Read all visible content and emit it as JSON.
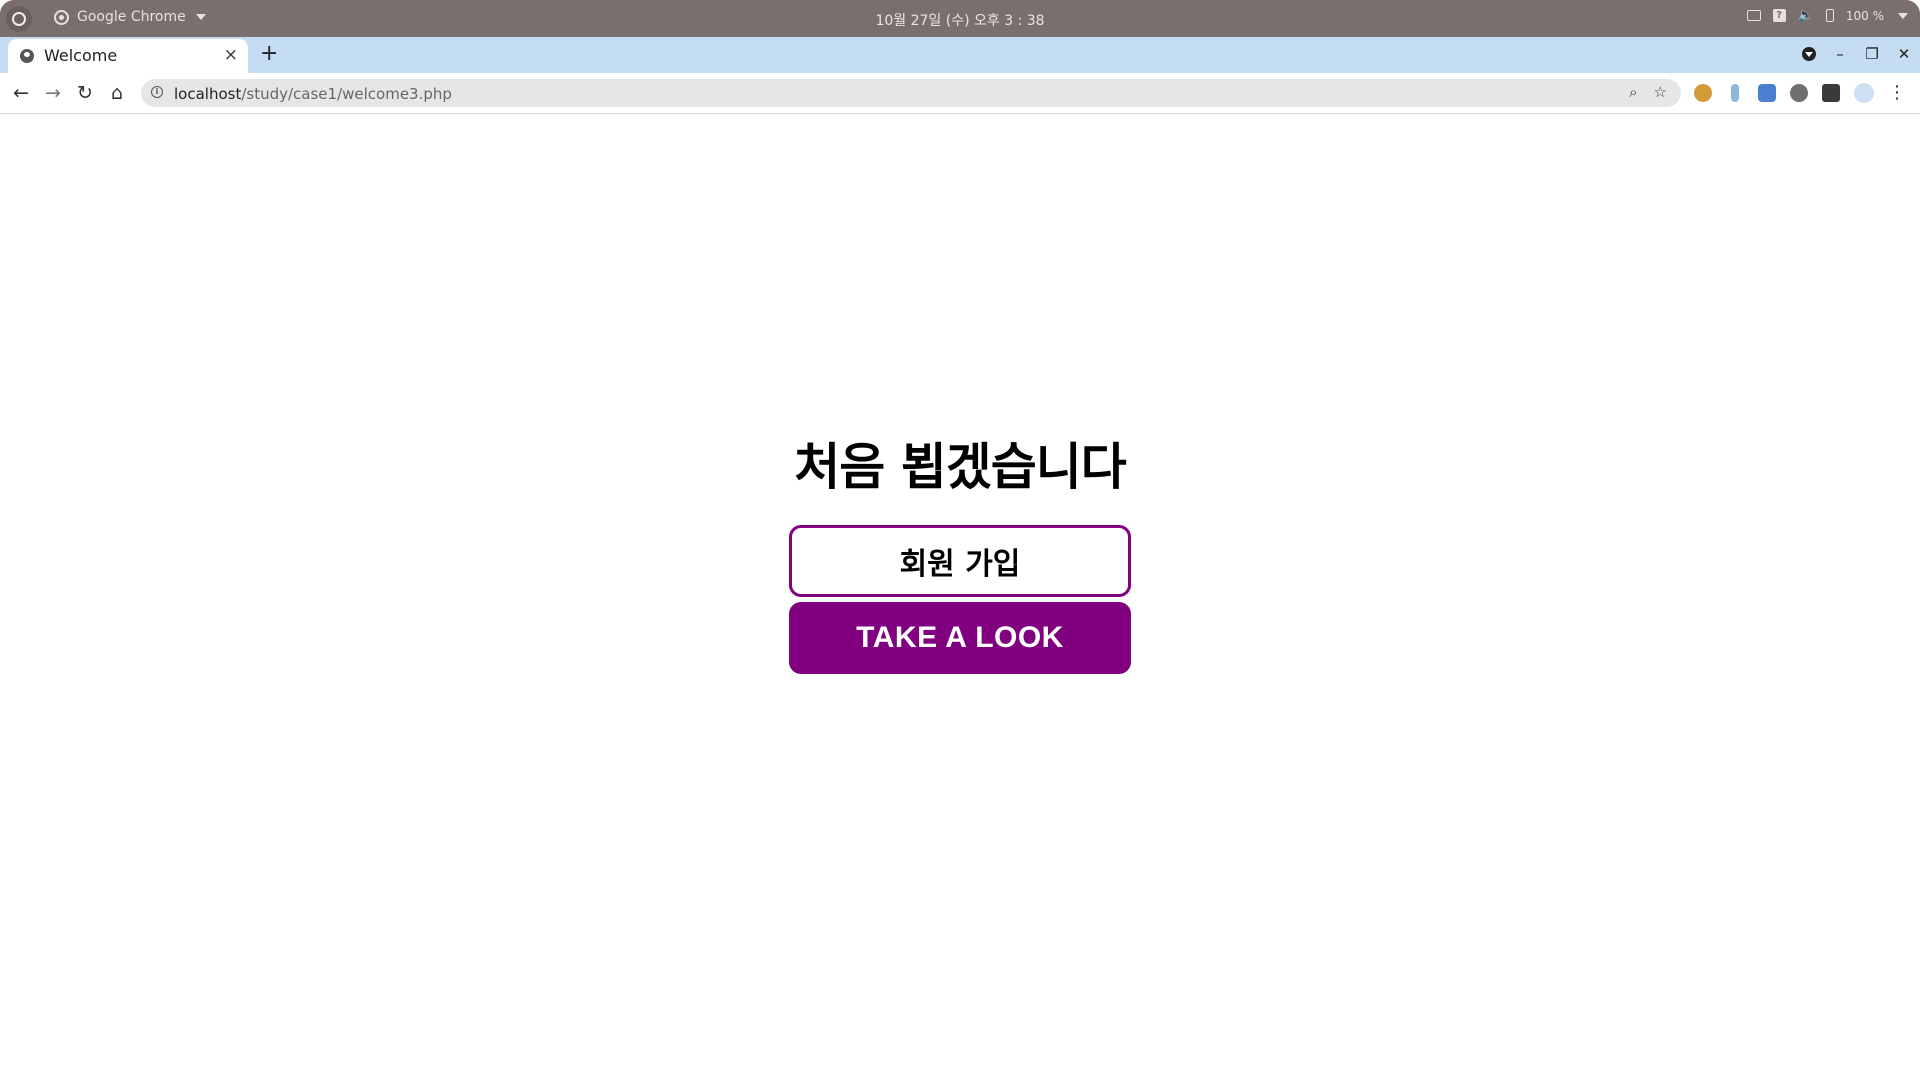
{
  "os_bar": {
    "app_name": "Google Chrome",
    "clock": "10월 27일 (수) 오후 3 : 38",
    "battery": "100 %"
  },
  "browser": {
    "tab_title": "Welcome",
    "tab_close": "×",
    "new_tab": "+",
    "url_host": "localhost",
    "url_path": "/study/case1/welcome3.php"
  },
  "page": {
    "heading": "처음 뵙겠습니다",
    "signup_label": "회원 가입",
    "look_label": "TAKE A LOOK"
  },
  "colors": {
    "accent": "#800080",
    "os_bar": "#7b6e6e",
    "tab_strip": "#c5ddf3"
  }
}
